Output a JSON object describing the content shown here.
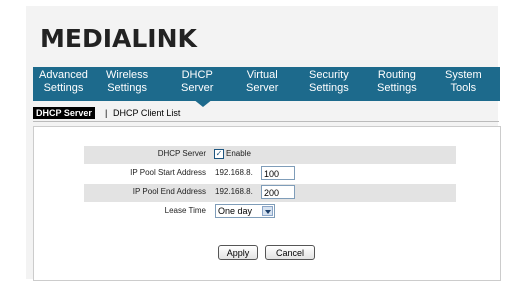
{
  "brand": {
    "logo_text": "MEDIALINK"
  },
  "nav": {
    "items": [
      {
        "line1": "Advanced",
        "line2": "Settings"
      },
      {
        "line1": "Wireless",
        "line2": "Settings"
      },
      {
        "line1": "DHCP",
        "line2": "Server"
      },
      {
        "line1": "Virtual",
        "line2": "Server"
      },
      {
        "line1": "Security",
        "line2": "Settings"
      },
      {
        "line1": "Routing",
        "line2": "Settings"
      },
      {
        "line1": "System",
        "line2": "Tools"
      }
    ],
    "active_index": 2
  },
  "subtabs": {
    "active": "DHCP Server",
    "separator": "|",
    "other": "DHCP Client List"
  },
  "form": {
    "dhcp_server_label": "DHCP Server",
    "enable_label": "Enable",
    "enable_checked": true,
    "pool_start_label": "IP Pool Start Address",
    "pool_start_prefix": "192.168.8.",
    "pool_start_value": "100",
    "pool_end_label": "IP Pool End Address",
    "pool_end_prefix": "192.168.8.",
    "pool_end_value": "200",
    "lease_time_label": "Lease Time",
    "lease_time_value": "One day"
  },
  "buttons": {
    "apply": "Apply",
    "cancel": "Cancel"
  }
}
